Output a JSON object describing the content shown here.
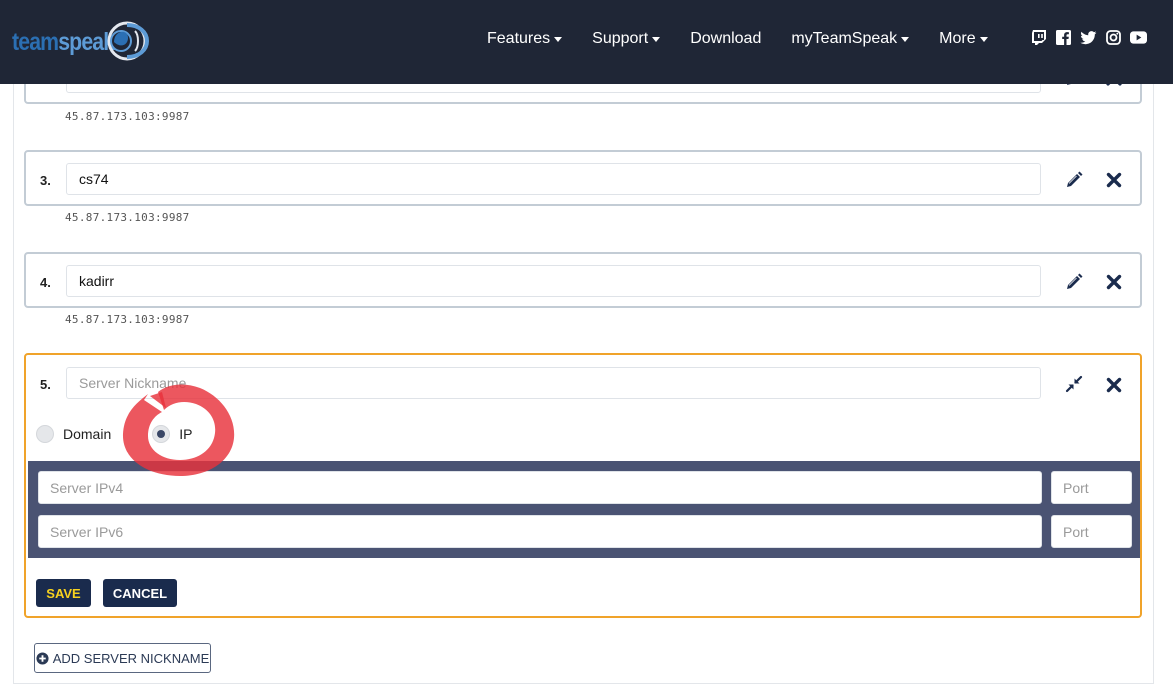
{
  "nav": {
    "logo_team": "team",
    "logo_speak": "speak",
    "items": [
      {
        "label": "Features",
        "has_caret": true
      },
      {
        "label": "Support",
        "has_caret": true
      },
      {
        "label": "Download",
        "has_caret": false
      },
      {
        "label": "myTeamSpeak",
        "has_caret": true
      },
      {
        "label": "More",
        "has_caret": true
      }
    ],
    "social_icons": [
      "twitch-icon",
      "facebook-icon",
      "twitter-icon",
      "instagram-icon",
      "youtube-icon"
    ]
  },
  "servers": [
    {
      "number": "",
      "name": "",
      "address": "45.87.173.103:9987"
    },
    {
      "number": "3.",
      "name": "cs74",
      "address": "45.87.173.103:9987"
    },
    {
      "number": "4.",
      "name": "kadirr",
      "address": "45.87.173.103:9987"
    }
  ],
  "new_server": {
    "number": "5.",
    "nickname_placeholder": "Server Nickname",
    "radio_domain": "Domain",
    "radio_ip": "IP",
    "selected": "IP",
    "ipv4_placeholder": "Server IPv4",
    "ipv6_placeholder": "Server IPv6",
    "port_placeholder": "Port",
    "save_label": "SAVE",
    "cancel_label": "CANCEL"
  },
  "add_button_label": "ADD SERVER NICKNAME",
  "colors": {
    "nav_bg": "#1f2636",
    "active_border": "#f0a32a",
    "button_bg": "#1a2b4d",
    "save_text": "#f7d21f",
    "ip_block_bg": "#4a5373",
    "annotation": "#e8323c"
  }
}
